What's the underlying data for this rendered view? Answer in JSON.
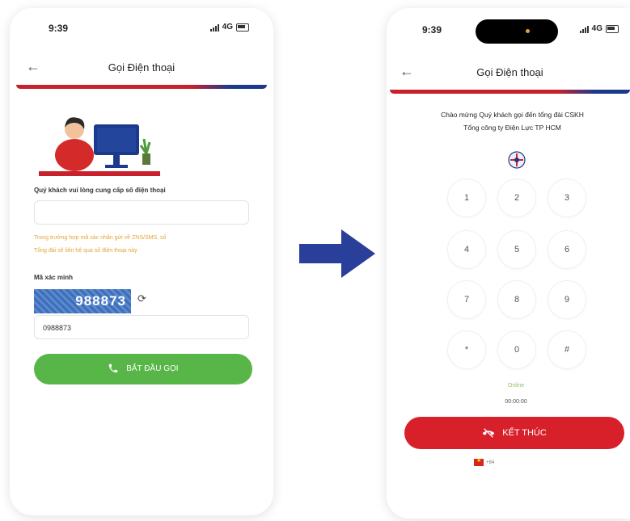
{
  "left_screen": {
    "status": {
      "time": "9:39",
      "network": "4G"
    },
    "header": {
      "title": "Gọi Điện thoại"
    },
    "phone_label": "Quý khách vui lòng cung cấp số điện thoại",
    "phone_input": {
      "value": "",
      "placeholder": ""
    },
    "hint_line1": "Trong trường hợp mã xác nhận gửi về ZNS/SMS, số",
    "hint_line2": "Tổng đài sẽ liên hệ qua số điện thoại này",
    "captcha_label": "Mã xác minh",
    "captcha_code": "988873",
    "captcha_input": {
      "value": "0988873"
    },
    "start_button": "BẮT ĐẦU GỌI"
  },
  "right_screen": {
    "status": {
      "time": "9:39",
      "network": "4G"
    },
    "header": {
      "title": "Gọi Điện thoại"
    },
    "welcome_line1": "Chào mừng Quý khách gọi đến tổng đài CSKH",
    "welcome_line2": "Tổng công ty Điện Lực TP HCM",
    "keys": [
      "1",
      "2",
      "3",
      "4",
      "5",
      "6",
      "7",
      "8",
      "9",
      "*",
      "0",
      "#"
    ],
    "call_state": "Online",
    "call_timer": "00:00:00",
    "end_button": "KẾT THÚC",
    "country_code": "+84"
  },
  "colors": {
    "brand_red": "#d8202a",
    "brand_blue": "#1c3a8c",
    "start_green": "#58b548",
    "hint_orange": "#e0a63a",
    "online_green": "#8fc36a",
    "arrow_blue": "#2a3f9a"
  },
  "icons": {
    "back": "arrow-left-icon",
    "refresh": "refresh-icon",
    "start_call": "phone-icon",
    "end_call": "phone-hangup-icon",
    "logo": "evn-logo-icon",
    "transition": "arrow-right-icon"
  }
}
